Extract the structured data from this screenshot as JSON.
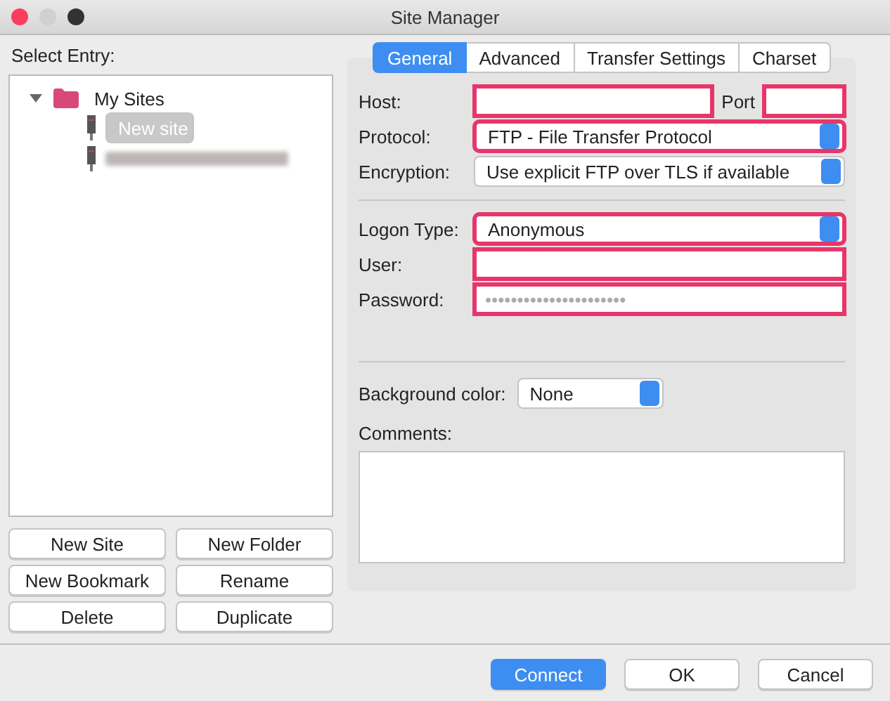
{
  "window": {
    "title": "Site Manager"
  },
  "select_entry_label": "Select Entry:",
  "tree": [
    {
      "label": "My Sites",
      "kind": "folder",
      "expanded": true,
      "children": [
        {
          "label": "New site",
          "kind": "site",
          "selected": true
        },
        {
          "kind": "redacted",
          "selected": false
        }
      ]
    }
  ],
  "left_buttons": [
    "New Site",
    "New Folder",
    "New Bookmark",
    "Rename",
    "Delete",
    "Duplicate"
  ],
  "tabs": [
    {
      "label": "General",
      "selected": true
    },
    {
      "label": "Advanced",
      "selected": false
    },
    {
      "label": "Transfer Settings",
      "selected": false
    },
    {
      "label": "Charset",
      "selected": false
    }
  ],
  "host": {
    "label": "Host:",
    "highlighted": true
  },
  "port": {
    "label": "Port",
    "highlighted": true
  },
  "general_fields": [
    {
      "label": "Protocol:",
      "kind": "select",
      "value": "FTP - File Transfer Protocol",
      "highlighted": true
    },
    {
      "label": "Encryption:",
      "kind": "select",
      "value": "Use explicit FTP over TLS if available",
      "highlighted": false
    }
  ],
  "logon_fields": [
    {
      "label": "Logon Type:",
      "kind": "select",
      "value": "Anonymous",
      "highlighted": true
    },
    {
      "label": "User:",
      "kind": "input",
      "highlighted": true
    },
    {
      "label": "Password:",
      "kind": "password",
      "placeholder": "••••••••••••••••••••••",
      "highlighted": true
    }
  ],
  "background_color": {
    "label": "Background color:",
    "value": "None"
  },
  "comments": {
    "label": "Comments:"
  },
  "footer_buttons": [
    {
      "label": "Connect",
      "default": true
    },
    {
      "label": "OK",
      "default": false
    },
    {
      "label": "Cancel",
      "default": false
    }
  ]
}
